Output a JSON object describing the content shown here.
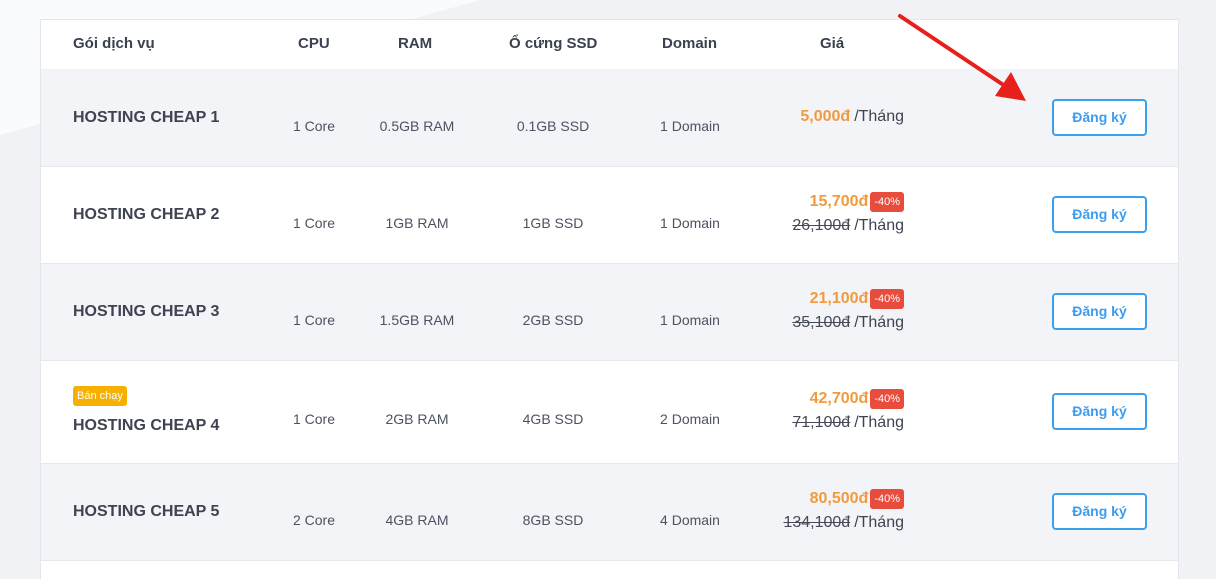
{
  "header": {
    "package": "Gói dịch vụ",
    "cpu": "CPU",
    "ram": "RAM",
    "ssd": "Ổ cứng SSD",
    "domain": "Domain",
    "price": "Giá"
  },
  "unit": "/Tháng",
  "register_label": "Đăng ký",
  "rows": [
    {
      "name": "HOSTING CHEAP 1",
      "cpu": "1 Core",
      "ram": "0.5GB RAM",
      "ssd": "0.1GB SSD",
      "domain": "1 Domain",
      "price": "5,000đ"
    },
    {
      "name": "HOSTING CHEAP 2",
      "cpu": "1 Core",
      "ram": "1GB RAM",
      "ssd": "1GB SSD",
      "domain": "1 Domain",
      "price": "15,700đ",
      "discount": "-40%",
      "old_price": "26,100đ"
    },
    {
      "name": "HOSTING CHEAP 3",
      "cpu": "1 Core",
      "ram": "1.5GB RAM",
      "ssd": "2GB SSD",
      "domain": "1 Domain",
      "price": "21,100đ",
      "discount": "-40%",
      "old_price": "35,100đ"
    },
    {
      "name": "HOSTING CHEAP 4",
      "badge": "Bán chạy",
      "cpu": "1 Core",
      "ram": "2GB RAM",
      "ssd": "4GB SSD",
      "domain": "2 Domain",
      "price": "42,700đ",
      "discount": "-40%",
      "old_price": "71,100đ"
    },
    {
      "name": "HOSTING CHEAP 5",
      "cpu": "2 Core",
      "ram": "4GB RAM",
      "ssd": "8GB SSD",
      "domain": "4 Domain",
      "price": "80,500đ",
      "discount": "-40%",
      "old_price": "134,100đ"
    }
  ],
  "colors": {
    "accent": "#3aa0f0",
    "price": "#f29a3c",
    "discount": "#e74c3c",
    "hot_badge": "#f5b000",
    "annotation_arrow": "#e8201c"
  }
}
